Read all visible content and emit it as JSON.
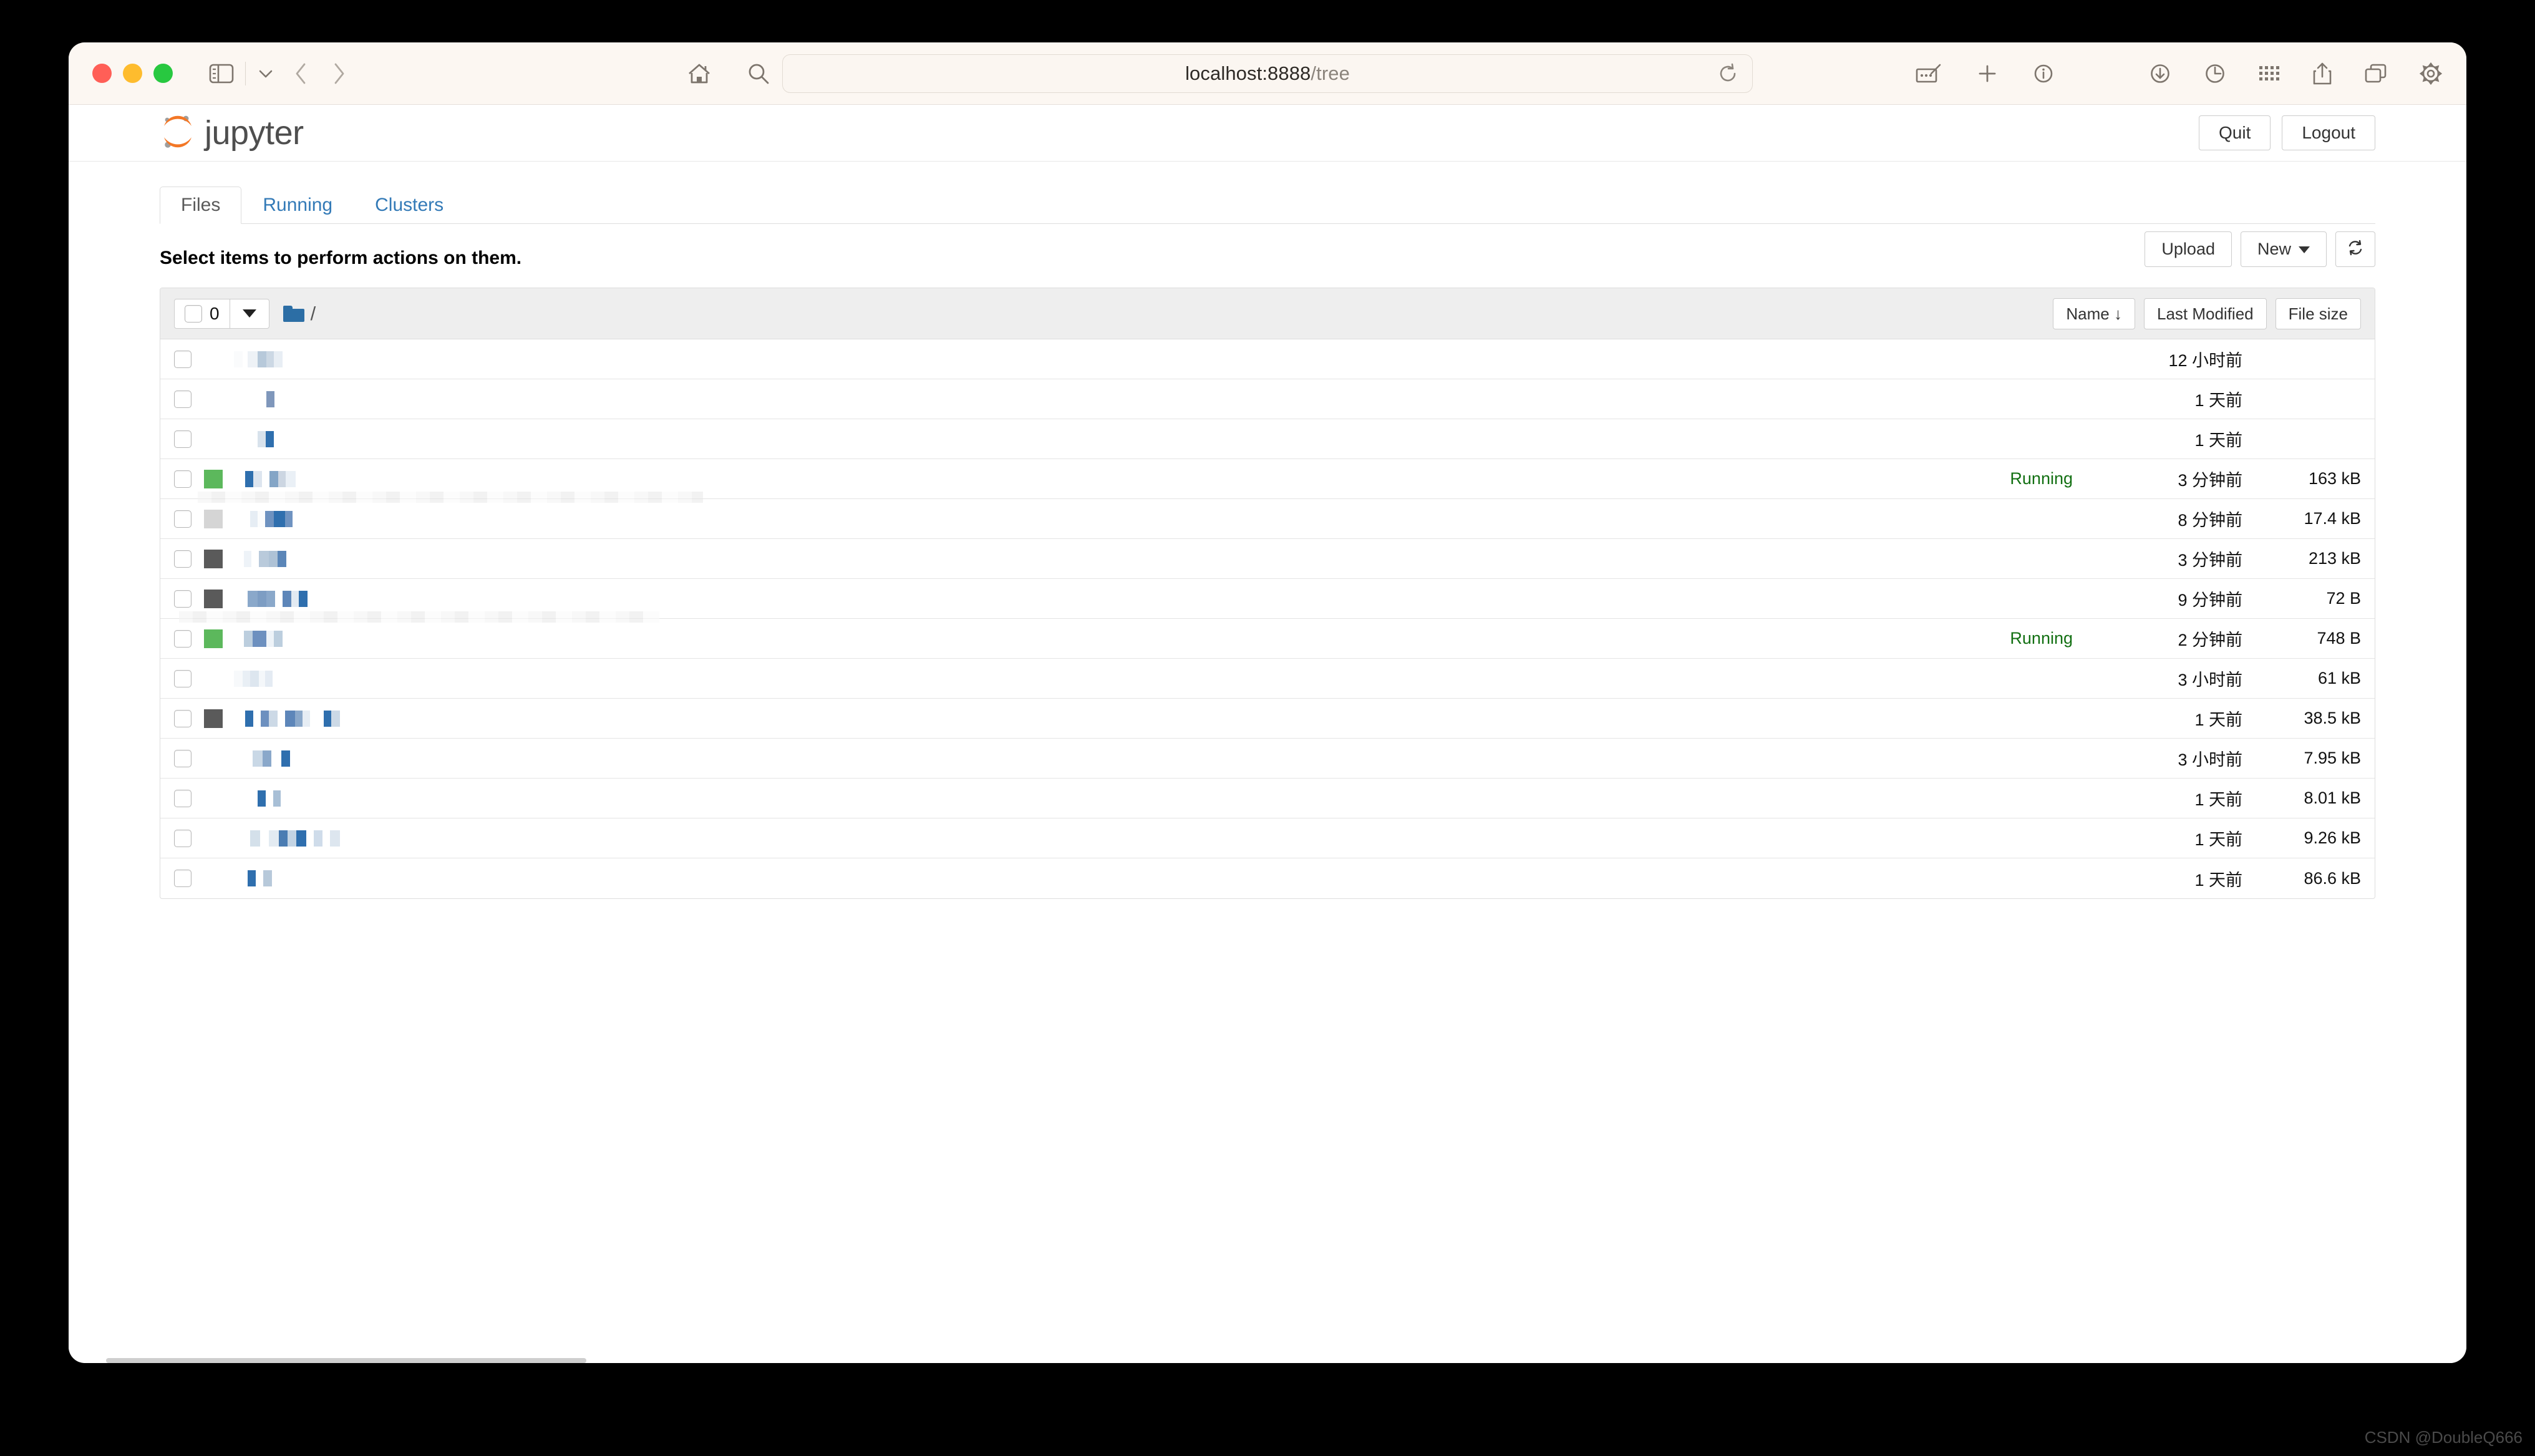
{
  "browser": {
    "url_host": "localhost:8888",
    "url_path": "/tree",
    "toolbar_icons": {
      "sidebar": "sidebar-icon",
      "sidebar_chevron": "chevron-down-icon",
      "back": "back-chevron-icon",
      "forward": "forward-chevron-icon",
      "home": "home-icon",
      "search": "search-icon",
      "extension": "download-shield-extension-icon",
      "privacy": "privacy-shield-icon",
      "reload": "reload-icon",
      "markup": "markup-edit-icon",
      "new_tab": "plus-icon",
      "info": "info-circle-icon",
      "downloads": "downloads-arrow-icon",
      "history": "clock-history-icon",
      "apps": "grid-apps-icon",
      "share": "share-upload-icon",
      "tabs": "tab-overview-icon",
      "settings": "gear-icon"
    }
  },
  "jupyter": {
    "brand": "jupyter",
    "logo_icon": "jupyter-logo-icon",
    "header_buttons": [
      {
        "label": "Quit",
        "name": "quit-button"
      },
      {
        "label": "Logout",
        "name": "logout-button"
      }
    ],
    "tabs": [
      {
        "label": "Files",
        "active": true
      },
      {
        "label": "Running",
        "active": false
      },
      {
        "label": "Clusters",
        "active": false
      }
    ],
    "select_note": "Select items to perform actions on them.",
    "list_actions": {
      "upload": "Upload",
      "new": "New",
      "refresh_icon": "refresh-icon"
    },
    "toolbar": {
      "selected_count": "0",
      "breadcrumb_root": "/",
      "folder_icon": "folder-icon",
      "dropdown_icon": "caret-down-icon"
    },
    "sort_buttons": [
      {
        "label": "Name ↓",
        "name": "sort-by-name-button"
      },
      {
        "label": "Last Modified",
        "name": "sort-by-modified-button"
      },
      {
        "label": "File size",
        "name": "sort-by-size-button"
      }
    ],
    "rows": [
      {
        "icon": "none",
        "status": "",
        "modified": "12 小时前",
        "size": "",
        "blocks": [
          [
            14,
            "#fafbfc"
          ],
          [
            8,
            "#ffffff"
          ],
          [
            16,
            "#eef2f6"
          ],
          [
            14,
            "#b7c9da"
          ],
          [
            12,
            "#ccd8e4"
          ],
          [
            14,
            "#e8eef4"
          ]
        ]
      },
      {
        "icon": "none",
        "status": "",
        "modified": "1 天前",
        "size": "",
        "blocks": [
          [
            52,
            "#ffffff"
          ],
          [
            13,
            "#7f97bb"
          ]
        ]
      },
      {
        "icon": "none",
        "status": "",
        "modified": "1 天前",
        "size": "",
        "blocks": [
          [
            38,
            "#ffffff"
          ],
          [
            13,
            "#d8e2ec"
          ],
          [
            13,
            "#2f6fae"
          ]
        ]
      },
      {
        "icon": "green",
        "status": "Running",
        "modified": "3 分钟前",
        "size": "163 kB",
        "blocks": [
          [
            18,
            "#ffffff"
          ],
          [
            13,
            "#2f6fae"
          ],
          [
            14,
            "#dde5ef"
          ],
          [
            12,
            "#ffffff"
          ],
          [
            14,
            "#84a5c6"
          ],
          [
            12,
            "#ccd6e2"
          ],
          [
            16,
            "#eaf0f6"
          ]
        ]
      },
      {
        "icon": "grey",
        "status": "",
        "modified": "8 分钟前",
        "size": "17.4 kB",
        "blocks": [
          [
            26,
            "#ffffff"
          ],
          [
            12,
            "#e6edf4"
          ],
          [
            12,
            "#fbfcfd"
          ],
          [
            14,
            "#6e92c0"
          ],
          [
            18,
            "#2f6fae"
          ],
          [
            12,
            "#6f93c1"
          ]
        ],
        "smudge": true
      },
      {
        "icon": "dark",
        "status": "",
        "modified": "3 分钟前",
        "size": "213 kB",
        "blocks": [
          [
            16,
            "#ffffff"
          ],
          [
            12,
            "#eef3f8"
          ],
          [
            12,
            "#ffffff"
          ],
          [
            16,
            "#b9cadb"
          ],
          [
            14,
            "#aec2d6"
          ],
          [
            14,
            "#5b86b8"
          ]
        ]
      },
      {
        "icon": "dark",
        "status": "",
        "modified": "9 分钟前",
        "size": "72 B",
        "blocks": [
          [
            22,
            "#ffffff"
          ],
          [
            16,
            "#8aa8ca"
          ],
          [
            14,
            "#7d9dc3"
          ],
          [
            14,
            "#8aa8ca"
          ],
          [
            12,
            "#ffffff"
          ],
          [
            14,
            "#5d86b9"
          ],
          [
            12,
            "#e2eaf2"
          ],
          [
            14,
            "#2f6fae"
          ]
        ]
      },
      {
        "icon": "green",
        "status": "Running",
        "modified": "2 分钟前",
        "size": "748 B",
        "blocks": [
          [
            16,
            "#ffffff"
          ],
          [
            14,
            "#bcceDE"
          ],
          [
            22,
            "#6d90bf"
          ],
          [
            12,
            "#eef3f8"
          ],
          [
            14,
            "#bccede"
          ]
        ],
        "smudge": true
      },
      {
        "icon": "none",
        "status": "",
        "modified": "3 小时前",
        "size": "61 kB",
        "blocks": [
          [
            14,
            "#f7f9fb"
          ],
          [
            12,
            "#e9eff5"
          ],
          [
            14,
            "#dde6ef"
          ],
          [
            10,
            "#f4f7fa"
          ],
          [
            12,
            "#e4ebf3"
          ]
        ]
      },
      {
        "icon": "dark",
        "status": "",
        "modified": "1 天前",
        "size": "38.5 kB",
        "blocks": [
          [
            18,
            "#ffffff"
          ],
          [
            13,
            "#2f6fae"
          ],
          [
            12,
            "#ffffff"
          ],
          [
            13,
            "#6d90bf"
          ],
          [
            14,
            "#ccd9e6"
          ],
          [
            12,
            "#ffffff"
          ],
          [
            16,
            "#5d86b9"
          ],
          [
            12,
            "#8aa8ca"
          ],
          [
            12,
            "#e6edf4"
          ],
          [
            22,
            "#ffffff"
          ],
          [
            12,
            "#2f6fae"
          ],
          [
            14,
            "#ccd9e6"
          ]
        ]
      },
      {
        "icon": "none",
        "status": "",
        "modified": "3 小时前",
        "size": "7.95 kB",
        "blocks": [
          [
            30,
            "#ffffff"
          ],
          [
            16,
            "#c9d8e6"
          ],
          [
            14,
            "#8aa8ca"
          ],
          [
            16,
            "#ffffff"
          ],
          [
            14,
            "#2f6fae"
          ]
        ]
      },
      {
        "icon": "none",
        "status": "",
        "modified": "1 天前",
        "size": "8.01 kB",
        "blocks": [
          [
            38,
            "#ffffff"
          ],
          [
            13,
            "#2f6fae"
          ],
          [
            12,
            "#ffffff"
          ],
          [
            12,
            "#a8bfd6"
          ]
        ]
      },
      {
        "icon": "none",
        "status": "",
        "modified": "1 天前",
        "size": "9.26 kB",
        "blocks": [
          [
            26,
            "#ffffff"
          ],
          [
            16,
            "#d4e0ea"
          ],
          [
            14,
            "#ffffff"
          ],
          [
            16,
            "#e3ebf2"
          ],
          [
            14,
            "#4a7cb2"
          ],
          [
            14,
            "#c3d4e4"
          ],
          [
            16,
            "#2f6fae"
          ],
          [
            12,
            "#ffffff"
          ],
          [
            14,
            "#cfdcea"
          ],
          [
            12,
            "#ffffff"
          ],
          [
            16,
            "#dde6ef"
          ]
        ]
      },
      {
        "icon": "none",
        "status": "",
        "modified": "1 天前",
        "size": "86.6 kB",
        "blocks": [
          [
            22,
            "#ffffff"
          ],
          [
            13,
            "#2f6fae"
          ],
          [
            12,
            "#ffffff"
          ],
          [
            14,
            "#b7c9da"
          ]
        ]
      }
    ]
  },
  "watermark": "CSDN @DoubleQ666"
}
